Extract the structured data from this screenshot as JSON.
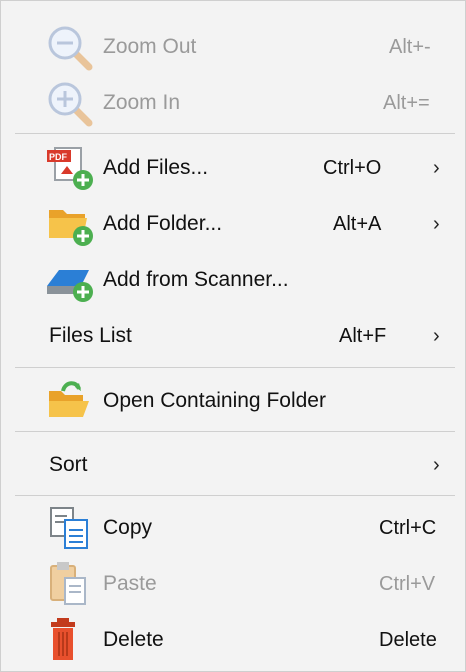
{
  "menu": {
    "zoom_out": {
      "label": "Zoom Out",
      "shortcut": "Alt+-"
    },
    "zoom_in": {
      "label": "Zoom In",
      "shortcut": "Alt+="
    },
    "add_files": {
      "label": "Add Files...",
      "shortcut": "Ctrl+O",
      "arrow": "›"
    },
    "add_folder": {
      "label": "Add Folder...",
      "shortcut": "Alt+A",
      "arrow": "›"
    },
    "add_scanner": {
      "label": "Add from Scanner..."
    },
    "files_list": {
      "label": "Files List",
      "shortcut": "Alt+F",
      "arrow": "›"
    },
    "open_folder": {
      "label": "Open Containing Folder"
    },
    "sort": {
      "label": "Sort",
      "arrow": "›"
    },
    "copy": {
      "label": "Copy",
      "shortcut": "Ctrl+C"
    },
    "paste": {
      "label": "Paste",
      "shortcut": "Ctrl+V"
    },
    "delete": {
      "label": "Delete",
      "shortcut": "Delete"
    }
  },
  "icons": {
    "zoom_out": "zoom-out-icon",
    "zoom_in": "zoom-in-icon",
    "add_files": "pdf-add-icon",
    "add_folder": "folder-add-icon",
    "add_scanner": "scanner-add-icon",
    "open_folder": "open-folder-icon",
    "copy": "copy-icon",
    "paste": "paste-icon",
    "delete": "trash-icon"
  },
  "colors": {
    "menu_bg": "#f3f3f3",
    "separator": "#cfcfcf",
    "disabled_text": "#9a9a9a",
    "add_badge": "#4caf50",
    "folder": "#f5b43a",
    "delete_red": "#e8502d"
  }
}
